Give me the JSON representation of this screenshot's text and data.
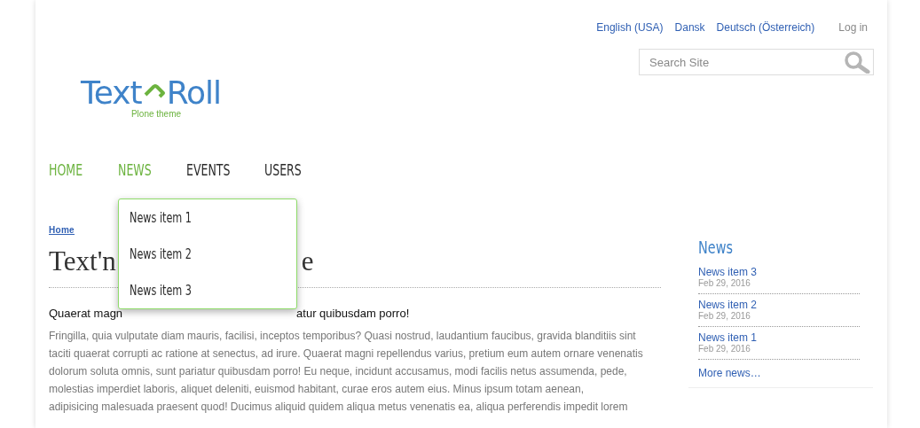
{
  "languages": [
    {
      "label": "English (USA)",
      "selected": false
    },
    {
      "label": "Dansk",
      "selected": false
    },
    {
      "label": "Deutsch (Österreich)",
      "selected": false
    }
  ],
  "login": "Log in",
  "search": {
    "placeholder": "Search Site"
  },
  "logo": {
    "left": "Text",
    "right": "Roll",
    "tagline": "Plone theme"
  },
  "nav": [
    {
      "label": "HOME",
      "selected": true
    },
    {
      "label": "NEWS",
      "selected": true
    },
    {
      "label": "EVENTS",
      "selected": false
    },
    {
      "label": "USERS",
      "selected": false
    }
  ],
  "dropdown": [
    "News item 1",
    "News item 2",
    "News item 3"
  ],
  "breadcrumb": "Home",
  "title": {
    "visible_start": "Text'n",
    "visible_end": "e"
  },
  "lead": {
    "visible_start": "Quaerat magn",
    "visible_end": "atur quibusdam porro!"
  },
  "body": "Fringilla, quia vulputate diam mauris, facilisi, inceptos temporibus? Quasi nostrud, laudantium faucibus, gravida blanditiis sint\ntaciti quaerat corrupti ac ratione at senectus, ad irure. Quaerat magni repellendus varius, pretium eum autem ornare venenatis\ndolorum soluta omnis, sunt pariatur quibusdam porro! Eu neque, incidunt accusamus, modi facilis netus assumenda, pede,\nmolestias imperdiet laboris, aliquet deleniti, euismod habitant, curae eros autem eius. Minus ipsum totam aenean,\nadipisicing malesuada praesent quod! Ducimus aliquid quidem aliqua metus venenatis ea, aliqua perferendis impedit lorem",
  "news_portlet": {
    "title": "News",
    "items": [
      {
        "title": "News item 3",
        "date": "Feb 29, 2016"
      },
      {
        "title": "News item 2",
        "date": "Feb 29, 2016"
      },
      {
        "title": "News item 1",
        "date": "Feb 29, 2016"
      }
    ],
    "more": "More news…"
  }
}
